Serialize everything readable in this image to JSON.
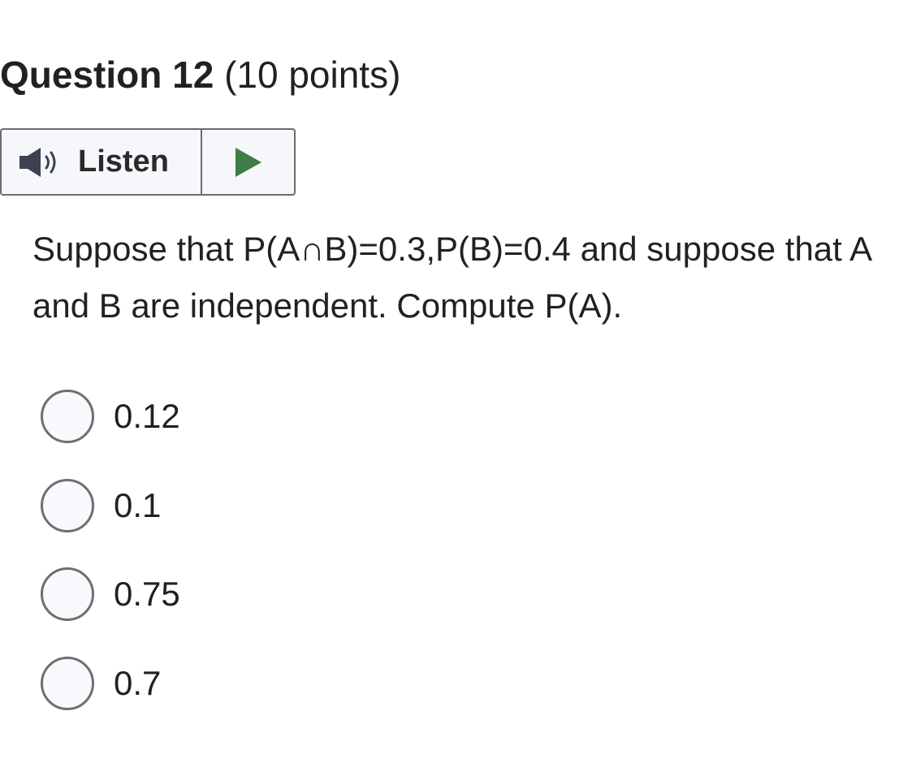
{
  "question": {
    "number_label": "Question 12",
    "points_label": "(10 points)",
    "text": "Suppose that P(A∩B)=0.3,P(B)=0.4 and suppose that A and B are independent. Compute P(A)."
  },
  "listen": {
    "label": "Listen",
    "speaker_icon": "speaker-icon",
    "play_icon": "play-icon",
    "play_color": "#3e7d46"
  },
  "options": [
    {
      "label": "0.12",
      "selected": false
    },
    {
      "label": "0.1",
      "selected": false
    },
    {
      "label": "0.75",
      "selected": false
    },
    {
      "label": "0.7",
      "selected": false
    }
  ]
}
